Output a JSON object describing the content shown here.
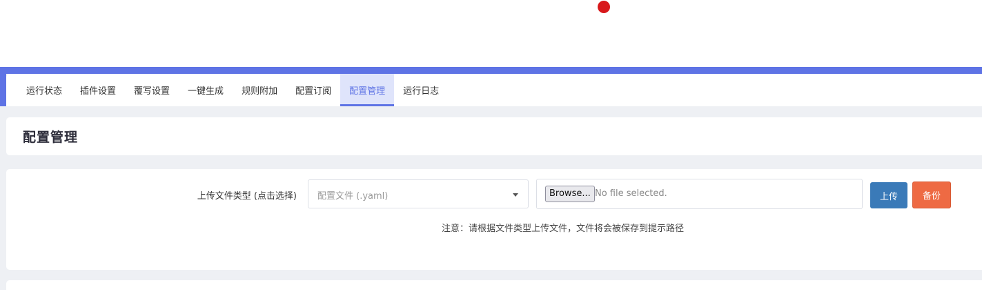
{
  "tabs": [
    {
      "label": "运行状态",
      "active": false
    },
    {
      "label": "插件设置",
      "active": false
    },
    {
      "label": "覆写设置",
      "active": false
    },
    {
      "label": "一键生成",
      "active": false
    },
    {
      "label": "规则附加",
      "active": false
    },
    {
      "label": "配置订阅",
      "active": false
    },
    {
      "label": "配置管理",
      "active": true
    },
    {
      "label": "运行日志",
      "active": false
    }
  ],
  "page": {
    "title": "配置管理"
  },
  "upload_form": {
    "type_label": "上传文件类型 (点击选择)",
    "type_select_value": "配置文件 (.yaml)",
    "browse_label": "Browse...",
    "file_status": "No file selected.",
    "upload_label": "上传",
    "backup_label": "备份",
    "note": "注意：请根据文件类型上传文件，文件将会被保存到提示路径"
  },
  "colors": {
    "accent": "#5e73e5",
    "active_tab_bg": "#dfe4fb",
    "upload_button": "#3a7ab8",
    "backup_button": "#ee6a43",
    "status_dot": "#d8181b"
  }
}
